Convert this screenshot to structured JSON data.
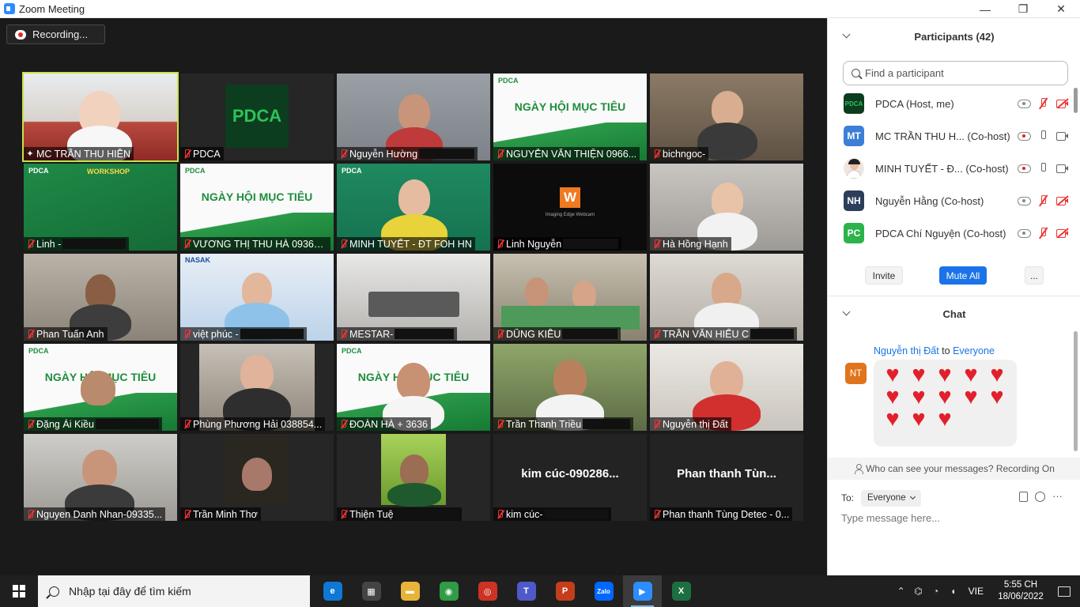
{
  "window": {
    "title": "Zoom Meeting",
    "minimize": "—",
    "maximize": "❐",
    "close": "✕"
  },
  "recording": {
    "label": "Recording..."
  },
  "tiles": [
    {
      "name": "MC TRẦN THU HIỀN"
    },
    {
      "name": "PDCA",
      "logo": "PDCA"
    },
    {
      "name": "Nguyễn Hường"
    },
    {
      "name": "NGUYỄN VĂN THIỆN 0966..."
    },
    {
      "name": "bichngoc-"
    },
    {
      "name": "Linh -"
    },
    {
      "name": "VƯƠNG THỊ THU HÀ 09365..."
    },
    {
      "name": "MINH TUYẾT - ĐT FOH HN"
    },
    {
      "name": "Linh Nguyễn"
    },
    {
      "name": "Hà Hồng Hạnh"
    },
    {
      "name": "Phan Tuấn Anh"
    },
    {
      "name": "việt phúc -"
    },
    {
      "name": "MESTAR-"
    },
    {
      "name": "DŨNG KIỀU"
    },
    {
      "name": "TRẦN VĂN HIẾU C"
    },
    {
      "name": "Đặng Ái Kiều"
    },
    {
      "name": "Phùng Phương Hải 038854..."
    },
    {
      "name": "ĐOÀN HÀ + 3636"
    },
    {
      "name": "Trần Thanh Triều"
    },
    {
      "name": "Nguyễn thị Đất"
    },
    {
      "name": "Nguyen Danh Nhan-09335..."
    },
    {
      "name": "Trần Minh Thơ"
    },
    {
      "name": "Thiện Tuệ"
    },
    {
      "name": "kim cúc-",
      "center": "kim cúc-090286..."
    },
    {
      "name": "Phan thanh Tùng Detec - 0...",
      "center": "Phan thanh Tùn..."
    }
  ],
  "banners": {
    "pdca_small": "PDCA",
    "ngay_hoi": "NGÀY HỘI MỤC TIÊU",
    "workshop": "WORKSHOP",
    "webcam_logo": "W",
    "webcam_text": "Imaging Edge Webcam",
    "nasak": "NASAK"
  },
  "participants": {
    "title": "Participants (42)",
    "search_placeholder": "Find a participant",
    "list": [
      {
        "initials": "",
        "name": "PDCA (Host, me)",
        "avatar_color": "#0c3d1e"
      },
      {
        "initials": "MT",
        "name": "MC TRẦN THU H... (Co-host)",
        "avatar_color": "#3d7fd6"
      },
      {
        "initials": "",
        "name": "MINH TUYẾT - Đ... (Co-host)",
        "avatar_color": "#f0e6e0"
      },
      {
        "initials": "NH",
        "name": "Nguyễn Hằng (Co-host)",
        "avatar_color": "#2d3e5a"
      },
      {
        "initials": "PC",
        "name": "PDCA Chí Nguyện (Co-host)",
        "avatar_color": "#2cb34b"
      }
    ],
    "invite": "Invite",
    "mute_all": "Mute All",
    "more": "..."
  },
  "chat": {
    "title": "Chat",
    "sender": "Nguyễn thị Đất",
    "to_word": "to",
    "recipient": "Everyone",
    "sender_initials": "NT",
    "hearts": [
      "♥",
      "♥",
      "♥",
      "♥",
      "♥",
      "♥",
      "♥",
      "♥",
      "♥",
      "♥",
      "♥",
      "♥",
      "♥"
    ],
    "who_can_see": "Who can see your messages? Recording On",
    "to_label": "To:",
    "to_value": "Everyone",
    "input_placeholder": "Type message here..."
  },
  "taskbar": {
    "search_placeholder": "Nhập tại đây để tìm kiếm",
    "language": "VIE",
    "time": "5:55 CH",
    "date": "18/06/2022",
    "apps": [
      {
        "label": "e",
        "color": "#0f78d4"
      },
      {
        "label": "▦",
        "color": "#444"
      },
      {
        "label": "▬",
        "color": "#e8b339"
      },
      {
        "label": "◉",
        "color": "#2f9c46"
      },
      {
        "label": "◎",
        "color": "#cc3322"
      },
      {
        "label": "T",
        "color": "#5059c9"
      },
      {
        "label": "P",
        "color": "#c43e1c"
      },
      {
        "label": "Zalo",
        "color": "#0068ff"
      },
      {
        "label": "▶",
        "color": "#2d8cff"
      },
      {
        "label": "X",
        "color": "#1d6f42"
      }
    ]
  },
  "colors": {
    "active_speaker": "#c5e34a",
    "accent": "#1a73e8",
    "muted": "#e33333"
  }
}
